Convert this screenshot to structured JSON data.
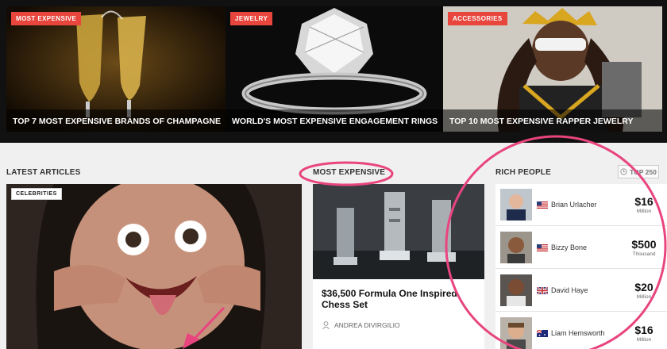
{
  "hero": [
    {
      "badge": "MOST EXPENSIVE",
      "caption": "TOP 7 MOST EXPENSIVE BRANDS OF CHAMPAGNE"
    },
    {
      "badge": "JEWELRY",
      "caption": "WORLD'S MOST EXPENSIVE ENGAGEMENT RINGS"
    },
    {
      "badge": "ACCESSORIES",
      "caption": "TOP 10 MOST EXPENSIVE RAPPER JEWELRY"
    }
  ],
  "latest": {
    "heading": "LATEST ARTICLES",
    "tag": "CELEBRITIES"
  },
  "middle": {
    "heading": "MOST EXPENSIVE",
    "title": "$36,500 Formula One Inspired Chess Set",
    "author": "ANDREA DIVIRGILIO",
    "author_icon": "user-icon"
  },
  "rich": {
    "heading": "RICH PEOPLE",
    "top_label": "TOP 250",
    "top_icon": "clock-icon",
    "people": [
      {
        "name": "Brian Urlacher",
        "flag": "us-flag",
        "worth": "$16",
        "unit": "Million"
      },
      {
        "name": "Bizzy Bone",
        "flag": "us-flag",
        "worth": "$500",
        "unit": "Thousand"
      },
      {
        "name": "David Haye",
        "flag": "uk-flag",
        "worth": "$20",
        "unit": "Million"
      },
      {
        "name": "Liam Hemsworth",
        "flag": "au-flag",
        "worth": "$16",
        "unit": "Million"
      }
    ]
  },
  "colors": {
    "accent": "#e8453c",
    "annotation": "#e8457f"
  }
}
